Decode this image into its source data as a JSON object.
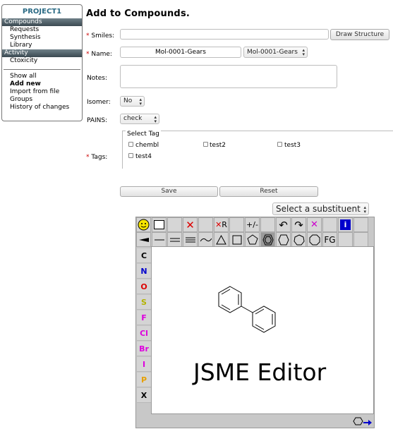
{
  "sidebar": {
    "project": "PROJECT1",
    "compounds_header": "Compounds",
    "compounds_items": [
      "Requests",
      "Synthesis",
      "Library"
    ],
    "activity_header": "Activity",
    "activity_items": [
      "Ctoxicity"
    ],
    "other_items": [
      "Show all",
      "Add new",
      "Import from file",
      "Groups",
      "History of changes"
    ],
    "bold_item": "Add new"
  },
  "form": {
    "title": "Add to Compounds.",
    "smiles_label": "Smiles:",
    "smiles_value": "",
    "draw_button": "Draw Structure",
    "name_label": "Name:",
    "name_value": "Mol-0001-Gears",
    "name_select": "Mol-0001-Gears",
    "notes_label": "Notes:",
    "notes_value": "",
    "isomer_label": "Isomer:",
    "isomer_value": "No",
    "pains_label": "PAINS:",
    "pains_value": "check",
    "tags_legend": "Select Tag",
    "tags_label": "Tags:",
    "tags": [
      "chembl",
      "test2",
      "test3",
      "test4"
    ],
    "save_button": "Save",
    "reset_button": "Reset",
    "substituent_select": "Select a substituent",
    "required_marker": "*"
  },
  "jsme": {
    "title": "JSME Editor",
    "atoms": [
      "C",
      "N",
      "O",
      "S",
      "F",
      "Cl",
      "Br",
      "I",
      "P",
      "X"
    ],
    "atom_colors": [
      "#000000",
      "#0000cc",
      "#dd0000",
      "#b3b300",
      "#dd00dd",
      "#dd00dd",
      "#dd00dd",
      "#dd00dd",
      "#e6a000",
      "#000000"
    ],
    "fg_button": "FG",
    "info_button": "i",
    "molecule": "biphenyl"
  }
}
